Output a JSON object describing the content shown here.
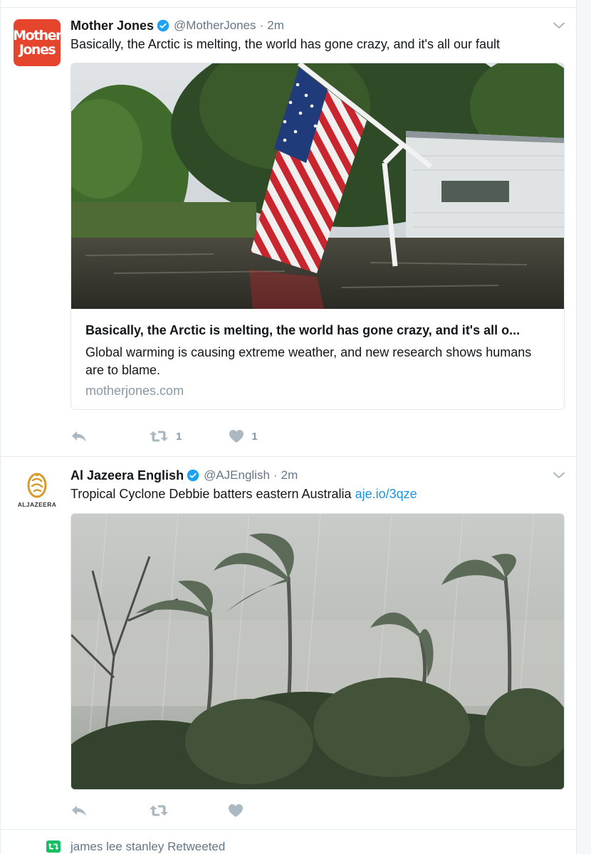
{
  "tweets": [
    {
      "author_name": "Mother Jones",
      "handle": "@MotherJones",
      "time": "2m",
      "avatar_text": [
        "Mother",
        "Jones"
      ],
      "text": "Basically, the Arctic is melting, the world has gone crazy, and it's all our fault",
      "card": {
        "title": "Basically, the Arctic is melting, the world has gone crazy, and it's all o...",
        "description": "Global warming is causing extreme weather, and new research shows humans are to blame.",
        "domain": "motherjones.com",
        "image_icon": "flooded-house-american-flag-photo"
      },
      "retweet_count": "1",
      "like_count": "1"
    },
    {
      "author_name": "Al Jazeera English",
      "handle": "@AJEnglish",
      "time": "2m",
      "avatar_wordmark": "ALJAZEERA",
      "text": "Tropical Cyclone Debbie batters eastern Australia",
      "link": "aje.io/3qze",
      "image_icon": "cyclone-palm-trees-photo"
    }
  ],
  "retweet_notice": "james lee stanley Retweeted",
  "colors": {
    "link": "#1b95e0",
    "verified": "#1da1f2",
    "action_icons": "#aab8c2",
    "retweet_badge": "#17bf63",
    "mother_jones_brand": "#e5452d"
  }
}
